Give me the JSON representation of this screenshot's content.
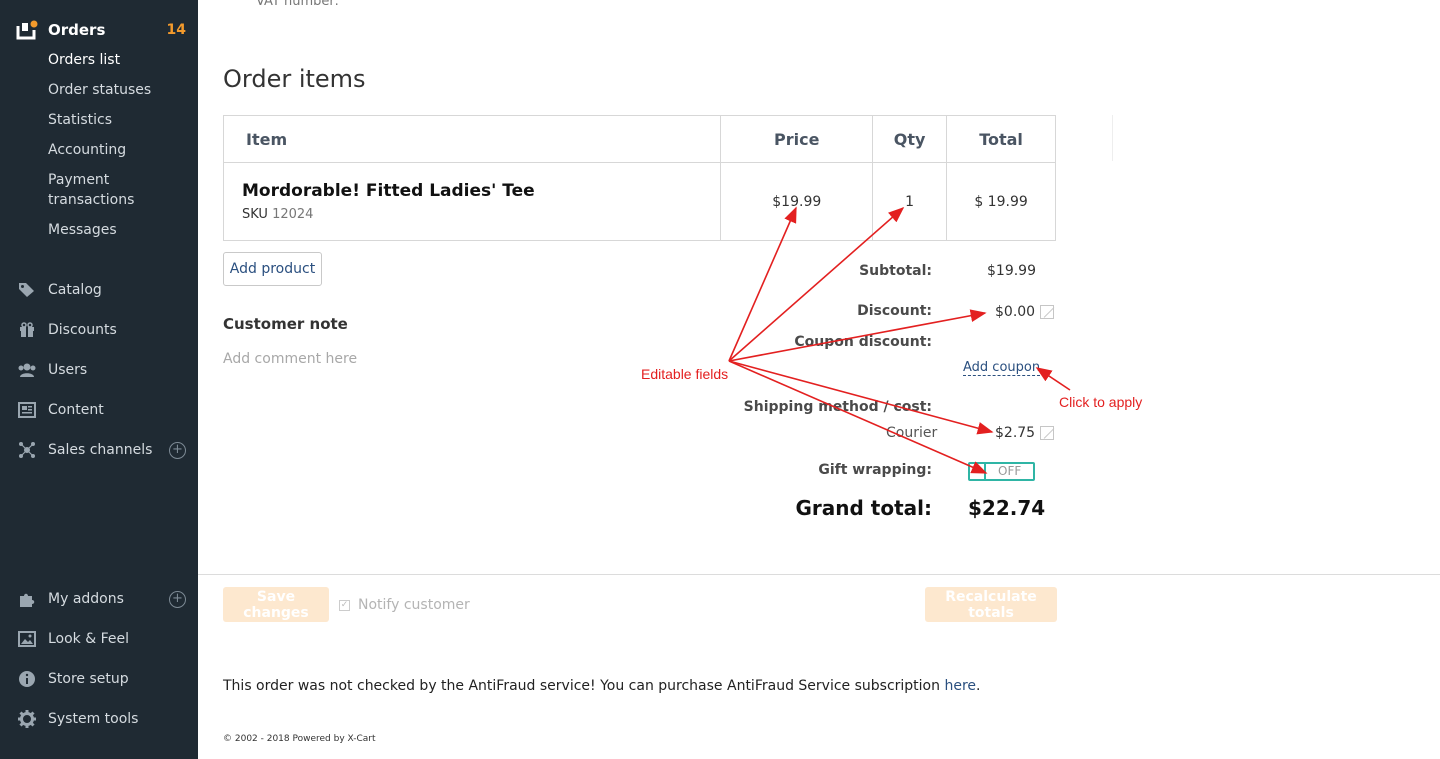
{
  "sidebar": {
    "orders_title": "Orders",
    "orders_badge": "14",
    "orders_sub": [
      "Orders list",
      "Order statuses",
      "Statistics",
      "Accounting",
      "Payment",
      "transactions",
      "Messages"
    ],
    "items": [
      {
        "label": "Catalog",
        "icon": "tag-icon"
      },
      {
        "label": "Discounts",
        "icon": "gift-icon"
      },
      {
        "label": "Users",
        "icon": "users-icon"
      },
      {
        "label": "Content",
        "icon": "newspaper-icon"
      },
      {
        "label": "Sales channels",
        "icon": "network-icon"
      },
      {
        "label": "My addons",
        "icon": "puzzle-icon"
      },
      {
        "label": "Look & Feel",
        "icon": "image-icon"
      },
      {
        "label": "Store setup",
        "icon": "info-icon"
      },
      {
        "label": "System tools",
        "icon": "gear-icon"
      }
    ],
    "accent": "#f39a2c"
  },
  "main": {
    "vat_label": "VAT number:",
    "section_title": "Order items",
    "table": {
      "headers": [
        "Item",
        "Price",
        "Qty",
        "Total"
      ],
      "row": {
        "name": "Mordorable! Fitted Ladies' Tee",
        "sku_label": "SKU",
        "sku": "12024",
        "price": "$19.99",
        "qty": "1",
        "total": "$ 19.99"
      }
    },
    "add_product": "Add product",
    "customer_note_label": "Customer note",
    "customer_note_placeholder": "Add comment here",
    "totals": {
      "subtotal_label": "Subtotal:",
      "subtotal": "$19.99",
      "discount_label": "Discount:",
      "discount": "$0.00",
      "coupon_label": "Coupon discount:",
      "add_coupon": "Add coupon",
      "shipping_label": "Shipping method / cost:",
      "shipping_method": "Courier",
      "shipping_cost": "$2.75",
      "gift_label": "Gift wrapping:",
      "gift_state": "OFF",
      "grand_label": "Grand total:",
      "grand_value": "$22.74"
    },
    "save_changes": "Save changes",
    "notify_customer": "Notify customer",
    "recalculate": "Recalculate totals",
    "antifraud_text": "This order was not checked by the AntiFraud service! You can purchase AntiFraud Service subscription",
    "antifraud_link": "here",
    "antifraud_end": ".",
    "footer": "© 2002 - 2018 Powered by X-Cart"
  },
  "annotations": {
    "editable": "Editable fields",
    "click_apply": "Click to apply",
    "color": "#e32020"
  }
}
